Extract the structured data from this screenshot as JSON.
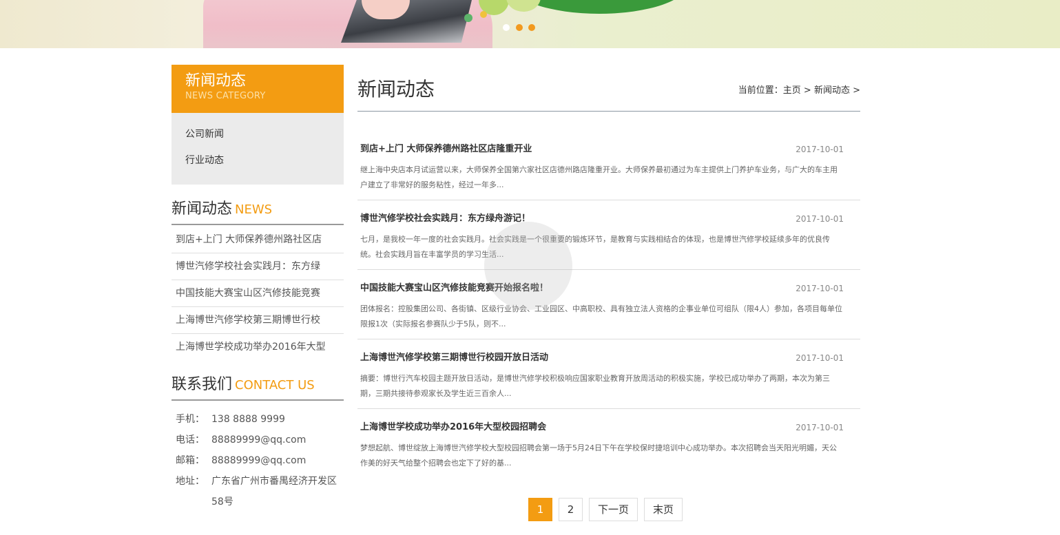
{
  "banner": {
    "carousel_dots": 3
  },
  "sidebar": {
    "category": {
      "title": "新闻动态",
      "subtitle": "NEWS CATEGORY",
      "items": [
        "公司新闻",
        "行业动态"
      ]
    },
    "news": {
      "title_cn": "新闻动态",
      "title_en": "NEWS",
      "items": [
        "到店+上门 大师保养德州路社区店",
        "博世汽修学校社会实践月：东方绿",
        "中国技能大赛宝山区汽修技能竞赛",
        "上海博世汽修学校第三期博世行校",
        "上海博世学校成功举办2016年大型"
      ]
    },
    "contact": {
      "title_cn": "联系我们",
      "title_en": "CONTACT US",
      "mobile_label": "手机：",
      "mobile": "138 8888 9999",
      "phone_label": "电话：",
      "phone": "88889999@qq.com",
      "email_label": "邮箱：",
      "email": "88889999@qq.com",
      "address_label": "地址：",
      "address": "广东省广州市番禺经济开发区58号"
    }
  },
  "main": {
    "title": "新闻动态",
    "breadcrumb": {
      "prefix": "当前位置：",
      "home": "主页",
      "sep1": " > ",
      "current": "新闻动态",
      "sep2": " >"
    },
    "articles": [
      {
        "title": "到店+上门 大师保养德州路社区店隆重开业",
        "date": "2017-10-01",
        "summary": "继上海中央店本月试运营以来，大师保养全国第六家社区店德州路店隆重开业。大师保养最初通过为车主提供上门养护车业务，与广大的车主用户建立了非常好的服务粘性，经过一年多..."
      },
      {
        "title": "博世汽修学校社会实践月：东方绿舟游记！",
        "date": "2017-10-01",
        "summary": "七月，是我校一年一度的社会实践月。社会实践是一个很重要的锻炼环节，是教育与实践相结合的体现，也是博世汽修学校延续多年的优良传统。社会实践月旨在丰富学员的学习生活..."
      },
      {
        "title": "中国技能大赛宝山区汽修技能竞赛开始报名啦！",
        "date": "2017-10-01",
        "summary": "团体报名：控股集团公司、各街镇、区级行业协会、工业园区、中高职校、具有独立法人资格的企事业单位可组队（限4人）参加，各项目每单位限报1次（实际报名参赛队少于5队，则不..."
      },
      {
        "title": "上海博世汽修学校第三期博世行校园开放日活动",
        "date": "2017-10-01",
        "summary": "摘要：博世行汽车校园主题开放日活动，是博世汽修学校积极响应国家职业教育开放周活动的积极实施，学校已成功举办了两期，本次为第三期，三期共接待参观家长及学生近三百余人..."
      },
      {
        "title": "上海博世学校成功举办2016年大型校园招聘会",
        "date": "2017-10-01",
        "summary": "梦想起航、博世绽放上海博世汽修学校大型校园招聘会第一场于5月24日下午在学校保时捷培训中心成功举办。本次招聘会当天阳光明媚，天公作美的好天气给整个招聘会也定下了好的基..."
      }
    ]
  },
  "pagination": {
    "page1": "1",
    "page2": "2",
    "next": "下一页",
    "last": "末页",
    "active_color": "#f39c12"
  },
  "colors": {
    "accent": "#f39c12",
    "sidebar_bg": "#ebebeb"
  }
}
